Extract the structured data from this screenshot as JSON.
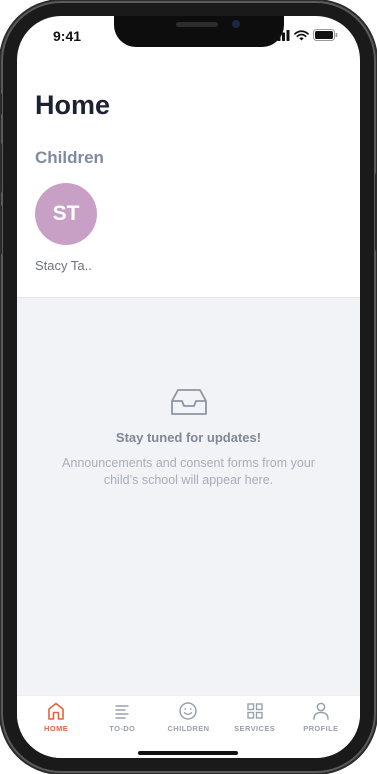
{
  "status_bar": {
    "time": "9:41"
  },
  "header": {
    "title": "Home"
  },
  "children_section": {
    "title": "Children",
    "children": [
      {
        "initials": "ST",
        "name": "Stacy Ta..",
        "avatar_color": "#c9a0c5"
      }
    ]
  },
  "updates": {
    "icon": "inbox-icon",
    "title": "Stay tuned for updates!",
    "message": "Announcements and consent forms from your child’s school will appear here."
  },
  "nav": {
    "active_color": "#e4643a",
    "items": [
      {
        "label": "HOME",
        "icon": "home-icon",
        "active": true
      },
      {
        "label": "TO-DO",
        "icon": "list-icon",
        "active": false
      },
      {
        "label": "CHILDREN",
        "icon": "smiley-icon",
        "active": false
      },
      {
        "label": "SERVICES",
        "icon": "grid-icon",
        "active": false
      },
      {
        "label": "PROFILE",
        "icon": "person-icon",
        "active": false
      }
    ]
  }
}
